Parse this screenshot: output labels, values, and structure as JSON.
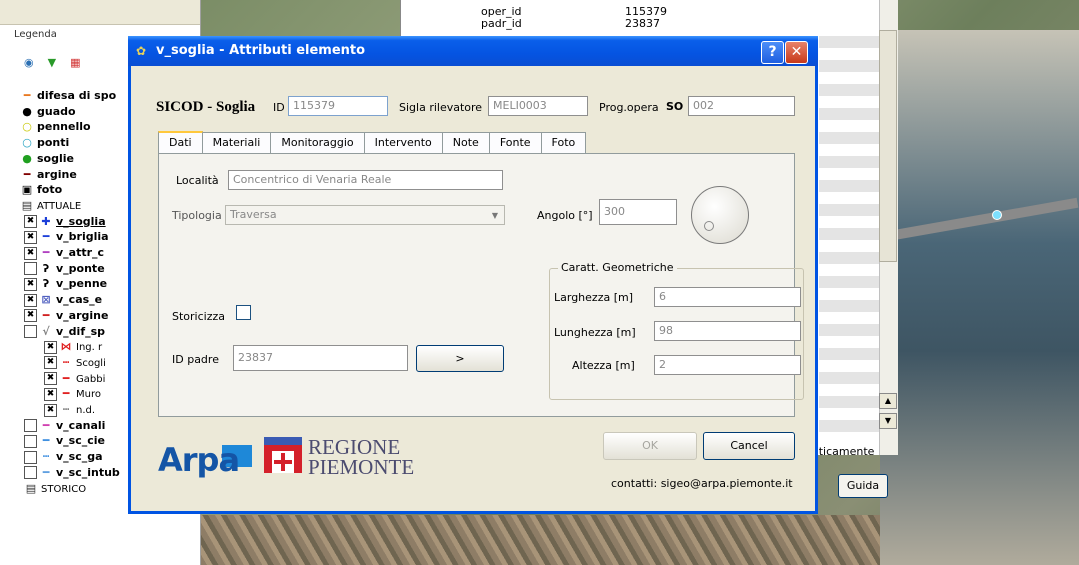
{
  "legend": {
    "title": "Legenda",
    "items": [
      {
        "icon": "orange-line-icon",
        "color": "#e87820",
        "label": "difesa di spo"
      },
      {
        "icon": "black-dot-icon",
        "color": "#000000",
        "label": "guado"
      },
      {
        "icon": "yellow-circle-icon",
        "color": "#c8c800",
        "label": "pennello"
      },
      {
        "icon": "cyan-circle-icon",
        "color": "#20a0c0",
        "label": "ponti"
      },
      {
        "icon": "green-dot-icon",
        "color": "#20a020",
        "label": "soglie"
      },
      {
        "icon": "darkred-line-icon",
        "color": "#800000",
        "label": "argine"
      },
      {
        "icon": "camera-icon",
        "color": "#000000",
        "label": "foto"
      },
      {
        "icon": "group-icon",
        "color": "#333333",
        "label": "ATTUALE"
      },
      {
        "icon": "plus-icon",
        "color": "#1c3fd8",
        "label": "v_soglia"
      },
      {
        "icon": "line-icon",
        "color": "#1c3fd8",
        "label": "v_briglia"
      },
      {
        "icon": "line-icon",
        "color": "#b040c0",
        "label": "v_attr_c"
      },
      {
        "icon": "hook-icon",
        "color": "#000000",
        "label": "v_ponte"
      },
      {
        "icon": "hook-icon",
        "color": "#000000",
        "label": "v_penne"
      },
      {
        "icon": "cross-box-icon",
        "color": "#5060c0",
        "label": "v_cas_e"
      },
      {
        "icon": "red-line-icon",
        "color": "#d02020",
        "label": "v_argine"
      },
      {
        "icon": "v-icon",
        "color": "#808080",
        "label": "v_dif_sp"
      },
      {
        "icon": "bowtie-icon",
        "color": "#e02020",
        "label": "Ing. r"
      },
      {
        "icon": "dashed-red-icon",
        "color": "#e02020",
        "label": "Scogli"
      },
      {
        "icon": "red-line-icon",
        "color": "#e02020",
        "label": "Gabbi"
      },
      {
        "icon": "red-line-icon",
        "color": "#e02020",
        "label": "Muro"
      },
      {
        "icon": "dashed-gray-icon",
        "color": "#808080",
        "label": "n.d."
      },
      {
        "icon": "magenta-line-icon",
        "color": "#d040b0",
        "label": "v_canali"
      },
      {
        "icon": "blue-line-icon",
        "color": "#4090e0",
        "label": "v_sc_cie"
      },
      {
        "icon": "dashed-blue-icon",
        "color": "#4090e0",
        "label": "v_sc_ga"
      },
      {
        "icon": "blue-line-icon",
        "color": "#60a0e0",
        "label": "v_sc_intub"
      },
      {
        "icon": "group-icon",
        "color": "#333333",
        "label": "STORICO"
      }
    ]
  },
  "attr_table": {
    "rows": [
      {
        "key": "oper_id",
        "value": "115379"
      },
      {
        "key": "padr_id",
        "value": "23837"
      }
    ],
    "autom_label": "aticamente",
    "guida_label": "Guida"
  },
  "dialog": {
    "title": "v_soglia - Attributi elemento",
    "header": {
      "sicod_label": "SICOD - Soglia",
      "id_label": "ID",
      "id_value": "115379",
      "rilevatore_label": "Sigla rilevatore",
      "rilevatore_value": "MELI0003",
      "progopera_label": "Prog.opera",
      "so_label": "SO",
      "progopera_value": "002"
    },
    "tabs": [
      "Dati",
      "Materiali",
      "Monitoraggio",
      "Intervento",
      "Note",
      "Fonte",
      "Foto"
    ],
    "dati": {
      "localita_label": "Località",
      "localita_value": "Concentrico di Venaria Reale",
      "tipologia_label": "Tipologia",
      "tipologia_value": "Traversa",
      "angolo_label": "Angolo [°]",
      "angolo_value": "300",
      "storicizza_label": "Storicizza",
      "idpadre_label": "ID padre",
      "idpadre_value": "23837",
      "goto_label": ">",
      "geom_title": "Caratt. Geometriche",
      "larghezza_label": "Larghezza [m]",
      "larghezza_value": "6",
      "lunghezza_label": "Lunghezza [m]",
      "lunghezza_value": "98",
      "altezza_label": "Altezza [m]",
      "altezza_value": "2"
    },
    "ok_label": "OK",
    "cancel_label": "Cancel",
    "contact": "contatti: sigeo@arpa.piemonte.it",
    "logo_arpa": "Arpa",
    "logo_regione_1": "REGIONE",
    "logo_regione_2": "PIEMONTE"
  }
}
